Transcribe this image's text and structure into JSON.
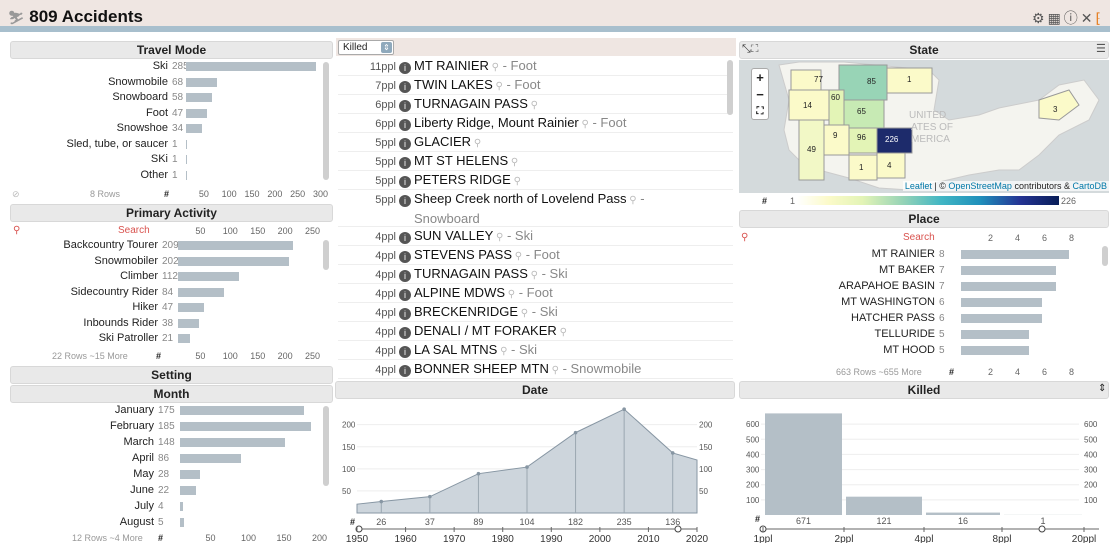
{
  "app": {
    "title": "809 Accidents",
    "icons": [
      "gear-icon",
      "table-icon",
      "info-icon",
      "close-icon",
      "logo-icon"
    ]
  },
  "travel": {
    "title": "Travel Mode",
    "max": 300,
    "items": [
      {
        "label": "Ski",
        "value": 285
      },
      {
        "label": "Snowmobile",
        "value": 68
      },
      {
        "label": "Snowboard",
        "value": 58
      },
      {
        "label": "Foot",
        "value": 47
      },
      {
        "label": "Snowshoe",
        "value": 34
      },
      {
        "label": "Sled, tube, or saucer",
        "value": 1
      },
      {
        "label": "SKi",
        "value": 1
      },
      {
        "label": "Other",
        "value": 1
      }
    ],
    "footer": "8 Rows",
    "ticks": [
      "#",
      "50",
      "100",
      "150",
      "200",
      "250",
      "300"
    ]
  },
  "activity": {
    "title": "Primary Activity",
    "search": "Search",
    "max": 250,
    "items": [
      {
        "label": "Backcountry Tourer",
        "value": 209
      },
      {
        "label": "Snowmobiler",
        "value": 202
      },
      {
        "label": "Climber",
        "value": 112
      },
      {
        "label": "Sidecountry Rider",
        "value": 84
      },
      {
        "label": "Hiker",
        "value": 47
      },
      {
        "label": "Inbounds Rider",
        "value": 38
      },
      {
        "label": "Ski Patroller",
        "value": 21
      }
    ],
    "footer": "22 Rows ~15 More",
    "ticks": [
      "#",
      "50",
      "100",
      "150",
      "200",
      "250"
    ],
    "top_ticks": [
      "50",
      "100",
      "150",
      "200",
      "250"
    ]
  },
  "setting": {
    "title": "Setting"
  },
  "month": {
    "title": "Month",
    "max": 200,
    "items": [
      {
        "label": "January",
        "value": 175
      },
      {
        "label": "February",
        "value": 185
      },
      {
        "label": "March",
        "value": 148
      },
      {
        "label": "April",
        "value": 86
      },
      {
        "label": "May",
        "value": 28
      },
      {
        "label": "June",
        "value": 22
      },
      {
        "label": "July",
        "value": 4
      },
      {
        "label": "August",
        "value": 5
      }
    ],
    "footer": "12 Rows ~4 More",
    "ticks": [
      "#",
      "50",
      "100",
      "150",
      "200"
    ]
  },
  "list": {
    "sort_value": "Killed",
    "rows": [
      {
        "ppl": "11ppl",
        "place": "MT RAINIER",
        "mode": " - Foot"
      },
      {
        "ppl": "7ppl",
        "place": "TWIN LAKES",
        "mode": " - Foot"
      },
      {
        "ppl": "6ppl",
        "place": "TURNAGAIN PASS",
        "mode": ""
      },
      {
        "ppl": "6ppl",
        "place": "Liberty Ridge, Mount Rainier",
        "mode": " - Foot"
      },
      {
        "ppl": "5ppl",
        "place": "GLACIER",
        "mode": ""
      },
      {
        "ppl": "5ppl",
        "place": "MT ST HELENS",
        "mode": ""
      },
      {
        "ppl": "5ppl",
        "place": "PETERS RIDGE",
        "mode": ""
      },
      {
        "ppl": "5ppl",
        "place": "Sheep Creek north of Lovelend Pass",
        "mode": " -",
        "mode2": "Snowboard"
      },
      {
        "ppl": "4ppl",
        "place": "SUN VALLEY",
        "mode": " - Ski"
      },
      {
        "ppl": "4ppl",
        "place": "STEVENS PASS",
        "mode": " - Foot"
      },
      {
        "ppl": "4ppl",
        "place": "TURNAGAIN PASS",
        "mode": " - Ski"
      },
      {
        "ppl": "4ppl",
        "place": "ALPINE MDWS",
        "mode": " - Foot"
      },
      {
        "ppl": "4ppl",
        "place": "BRECKENRIDGE",
        "mode": " - Ski"
      },
      {
        "ppl": "4ppl",
        "place": "DENALI / MT FORAKER",
        "mode": ""
      },
      {
        "ppl": "4ppl",
        "place": "LA SAL MTNS",
        "mode": " - Ski"
      },
      {
        "ppl": "4ppl",
        "place": "BONNER SHEEP MTN",
        "mode": " - Snowmobile"
      }
    ]
  },
  "state": {
    "title": "State",
    "attribution_leaflet": "Leaflet",
    "attribution_mid": " | © ",
    "attribution_osm": "OpenStreetMap",
    "attribution_tail": " contributors & ",
    "attribution_carto": "CartoDB",
    "legend_min": "1",
    "legend_max": "226",
    "legend_hash": "#",
    "labels": [
      "77",
      "85",
      "1",
      "14",
      "60",
      "65",
      "9",
      "96",
      "226",
      "49",
      "1",
      "4",
      "3"
    ],
    "map_text": [
      "UNITED",
      "ATES OF",
      "MERICA"
    ]
  },
  "place": {
    "title": "Place",
    "search": "Search",
    "max": 8,
    "items": [
      {
        "label": "MT RAINIER",
        "value": 8
      },
      {
        "label": "MT BAKER",
        "value": 7
      },
      {
        "label": "ARAPAHOE BASIN",
        "value": 7
      },
      {
        "label": "MT WASHINGTON",
        "value": 6
      },
      {
        "label": "HATCHER PASS",
        "value": 6
      },
      {
        "label": "TELLURIDE",
        "value": 5
      },
      {
        "label": "MT HOOD",
        "value": 5
      }
    ],
    "footer": "663 Rows ~655 More",
    "ticks": [
      "#",
      "2",
      "4",
      "6",
      "8"
    ],
    "top_ticks": [
      "2",
      "4",
      "6",
      "8"
    ]
  },
  "date": {
    "title": "Date",
    "axis_ticks": [
      "1950",
      "1960",
      "1970",
      "1980",
      "1990",
      "2000",
      "2010",
      "2020"
    ],
    "y_ticks": [
      "50",
      "100",
      "150",
      "200"
    ]
  },
  "killed": {
    "title": "Killed",
    "y_ticks": [
      "100",
      "200",
      "300",
      "400",
      "500",
      "600"
    ],
    "axis_ticks": [
      "1ppl",
      "2ppl",
      "4ppl",
      "8ppl",
      "20ppl"
    ]
  },
  "chart_data": [
    {
      "type": "area",
      "title": "Date",
      "x": [
        1955,
        1965,
        1975,
        1985,
        1995,
        2005,
        2015
      ],
      "values": [
        26,
        37,
        89,
        104,
        182,
        235,
        136
      ],
      "ylim": [
        0,
        240
      ]
    },
    {
      "type": "bar",
      "title": "Killed",
      "categories": [
        "1ppl",
        "2ppl",
        "4ppl",
        "8ppl"
      ],
      "values": [
        671,
        121,
        16,
        1
      ],
      "ylim": [
        0,
        700
      ]
    }
  ]
}
